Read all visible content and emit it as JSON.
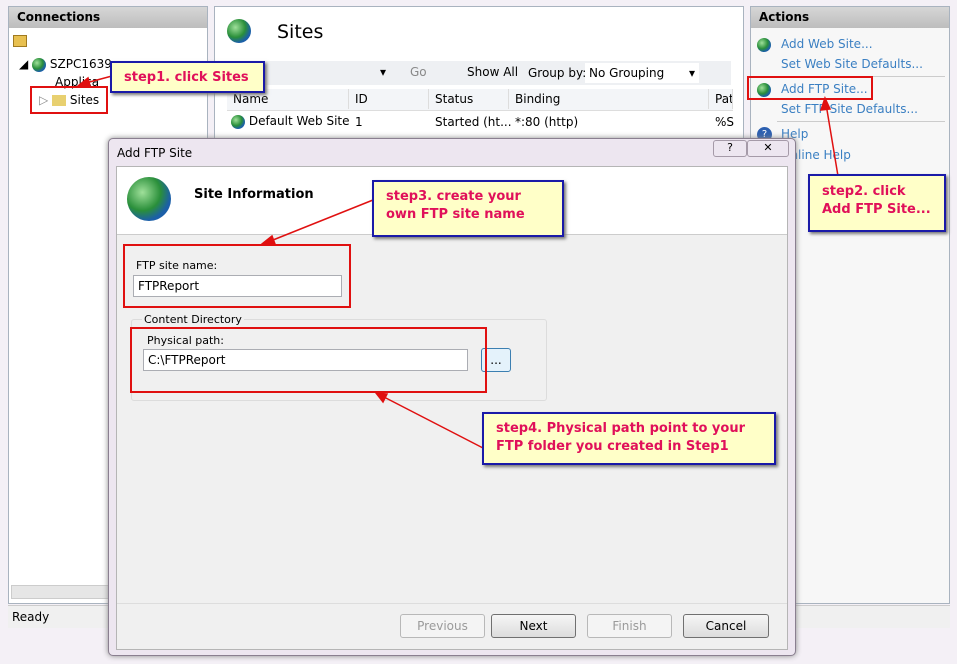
{
  "connections": {
    "title": "Connections",
    "server": "SZPC1639",
    "app_pools": "Applica",
    "sites": "Sites"
  },
  "main": {
    "title": "Sites",
    "go": "Go",
    "show_all": "Show All",
    "group_by_label": "Group by:",
    "group_by_value": "No Grouping",
    "columns": [
      "Name",
      "ID",
      "Status",
      "Binding",
      "Pat"
    ],
    "rows": [
      [
        "Default Web Site",
        "1",
        "Started (ht...",
        "*:80 (http)",
        "%S"
      ]
    ]
  },
  "actions": {
    "title": "Actions",
    "items": [
      "Add Web Site...",
      "Set Web Site Defaults...",
      "Add FTP Site...",
      "Set FTP Site Defaults...",
      "Help",
      "Online Help"
    ]
  },
  "status": {
    "text": "Ready"
  },
  "dialog": {
    "title": "Add FTP Site",
    "help": "?",
    "close": "✕",
    "header": "Site Information",
    "site_name_label": "FTP site name:",
    "site_name_value": "FTPReport",
    "content_dir_label": "Content Directory",
    "physical_path_label": "Physical path:",
    "physical_path_value": "C:\\FTPReport",
    "browse": "...",
    "buttons": {
      "previous": "Previous",
      "next": "Next",
      "finish": "Finish",
      "cancel": "Cancel"
    }
  },
  "annotations": {
    "step1": "step1. click Sites",
    "step2": "step2. click Add FTP Site...",
    "step3": "step3. create your own FTP site name",
    "step4": "step4. Physical path point to your FTP folder you created in Step1"
  },
  "colors": {
    "annotation_text": "#e0105a",
    "annotation_border": "#1a1aa8",
    "highlight": "#e01010",
    "link": "#3a7fc2"
  }
}
